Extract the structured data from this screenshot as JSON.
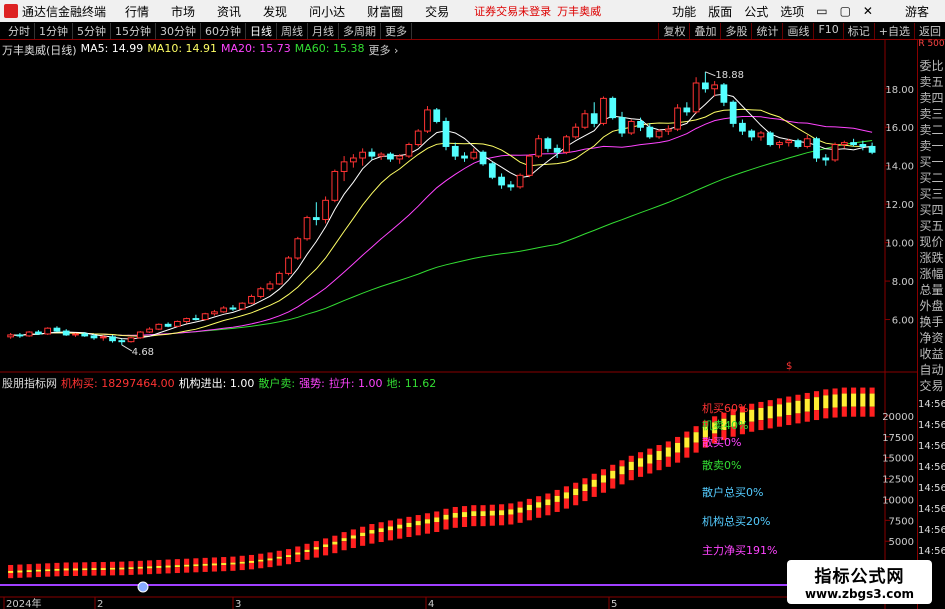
{
  "titlebar": {
    "app_title": "通达信金融终端",
    "menu": [
      "行情",
      "市场",
      "资讯",
      "发现",
      "问小达",
      "财富圈",
      "交易"
    ],
    "warning": "证券交易未登录",
    "stock_name": "万丰奥威",
    "right_items": [
      "功能",
      "版面",
      "公式",
      "选项"
    ],
    "guest": "游客",
    "window_controls": [
      "minimize-icon",
      "restore-icon",
      "close-icon"
    ]
  },
  "toolbar": {
    "periods": [
      "分时",
      "1分钟",
      "5分钟",
      "15分钟",
      "30分钟",
      "60分钟",
      "日线",
      "周线",
      "月线",
      "多周期",
      "更多"
    ],
    "active_period": "日线",
    "tools": [
      "复权",
      "叠加",
      "多股",
      "统计",
      "画线",
      "F10",
      "标记",
      "+自选",
      "返回"
    ]
  },
  "sidebar": {
    "top": "R 500",
    "items": [
      "委比",
      "卖五",
      "卖四",
      "卖三",
      "卖二",
      "卖一",
      "买一",
      "买二",
      "买三",
      "买四",
      "买五",
      "现价",
      "涨跌",
      "涨幅",
      "总量",
      "外盘",
      "换手",
      "净资",
      "收益",
      "自动",
      "交易",
      "14:56",
      "14:56",
      "14:56",
      "14:56",
      "14:56",
      "14:56",
      "14:56",
      "14:56"
    ]
  },
  "main_legend": {
    "name": "万丰奥威(日线)",
    "ma5": "MA5: 14.99",
    "ma10": "MA10: 14.91",
    "ma20": "MA20: 15.73",
    "ma60": "MA60: 15.38",
    "colors": {
      "ma5": "#ffffff",
      "ma10": "#ffff66",
      "ma20": "#ff44ff",
      "ma60": "#33dd33"
    }
  },
  "main_axis": {
    "ticks": [
      "18.00",
      "16.00",
      "14.00",
      "12.00",
      "10.00",
      "8.00",
      "6.00"
    ],
    "high_label": "18.88",
    "low_label": "4.68"
  },
  "ind_legend": {
    "name": "股朋指标网",
    "jgm": "机构买: 18297464.00",
    "jgjc": "机构进出: 1.00",
    "shm": "散户卖:",
    "qs": "强势:",
    "ls": "拉升: 1.00",
    "d": "地: 11.62"
  },
  "ind_axis": {
    "ticks": [
      "20000",
      "17500",
      "15000",
      "12500",
      "10000",
      "7500",
      "5000"
    ]
  },
  "ind_labels": [
    {
      "text": "机买60%",
      "color": "#ff3333"
    },
    {
      "text": "机卖40%",
      "color": "#33dd33"
    },
    {
      "text": "散买0%",
      "color": "#ff44ff"
    },
    {
      "text": "散卖0%",
      "color": "#33dd33"
    },
    {
      "text": "散户总买0%",
      "color": "#55ccff"
    },
    {
      "text": "机构总买20%",
      "color": "#55ccff"
    },
    {
      "text": "主力净买191%",
      "color": "#ff44ff"
    }
  ],
  "time_axis": [
    "2024年",
    "2",
    "3",
    "4",
    "5"
  ],
  "watermark": {
    "line1": "指标公式网",
    "line2": "www.zbgs3.com"
  },
  "chart_data": {
    "type": "candlestick",
    "ylim": [
      4.0,
      19.6
    ],
    "candles": [
      [
        5.1,
        5.3,
        5.0,
        5.2
      ],
      [
        5.2,
        5.3,
        5.05,
        5.15
      ],
      [
        5.15,
        5.4,
        5.1,
        5.35
      ],
      [
        5.35,
        5.45,
        5.2,
        5.25
      ],
      [
        5.25,
        5.6,
        5.2,
        5.55
      ],
      [
        5.55,
        5.65,
        5.35,
        5.4
      ],
      [
        5.4,
        5.5,
        5.15,
        5.2
      ],
      [
        5.2,
        5.3,
        5.1,
        5.25
      ],
      [
        5.25,
        5.35,
        5.1,
        5.15
      ],
      [
        5.15,
        5.25,
        4.95,
        5.05
      ],
      [
        5.05,
        5.2,
        4.9,
        5.1
      ],
      [
        5.1,
        5.2,
        4.8,
        4.9
      ],
      [
        4.9,
        5.0,
        4.68,
        4.85
      ],
      [
        4.85,
        5.1,
        4.8,
        5.05
      ],
      [
        5.05,
        5.4,
        5.0,
        5.35
      ],
      [
        5.35,
        5.6,
        5.3,
        5.5
      ],
      [
        5.5,
        5.8,
        5.45,
        5.75
      ],
      [
        5.75,
        5.85,
        5.6,
        5.65
      ],
      [
        5.65,
        5.95,
        5.6,
        5.9
      ],
      [
        5.9,
        6.1,
        5.8,
        6.05
      ],
      [
        6.05,
        6.25,
        5.95,
        6.0
      ],
      [
        6.0,
        6.35,
        5.95,
        6.3
      ],
      [
        6.3,
        6.5,
        6.2,
        6.4
      ],
      [
        6.4,
        6.7,
        6.35,
        6.6
      ],
      [
        6.6,
        6.75,
        6.45,
        6.55
      ],
      [
        6.55,
        6.9,
        6.5,
        6.85
      ],
      [
        6.85,
        7.3,
        6.8,
        7.2
      ],
      [
        7.2,
        7.7,
        7.1,
        7.6
      ],
      [
        7.6,
        8.0,
        7.5,
        7.85
      ],
      [
        7.85,
        8.5,
        7.8,
        8.4
      ],
      [
        8.4,
        9.3,
        8.3,
        9.2
      ],
      [
        9.2,
        10.3,
        9.1,
        10.2
      ],
      [
        10.2,
        11.4,
        10.1,
        11.3
      ],
      [
        11.3,
        12.1,
        10.9,
        11.2
      ],
      [
        11.2,
        12.4,
        11.0,
        12.2
      ],
      [
        12.2,
        13.8,
        12.1,
        13.7
      ],
      [
        13.7,
        14.5,
        13.2,
        14.2
      ],
      [
        14.2,
        14.6,
        13.9,
        14.4
      ],
      [
        14.4,
        14.9,
        14.0,
        14.7
      ],
      [
        14.7,
        14.9,
        14.3,
        14.5
      ],
      [
        14.5,
        14.7,
        14.3,
        14.6
      ],
      [
        14.6,
        14.7,
        14.2,
        14.35
      ],
      [
        14.35,
        14.6,
        14.1,
        14.5
      ],
      [
        14.5,
        15.2,
        14.4,
        15.1
      ],
      [
        15.1,
        15.9,
        15.0,
        15.8
      ],
      [
        15.8,
        17.1,
        15.7,
        16.9
      ],
      [
        16.9,
        17.0,
        16.2,
        16.3
      ],
      [
        16.3,
        16.5,
        14.8,
        15.0
      ],
      [
        15.0,
        15.2,
        14.3,
        14.5
      ],
      [
        14.5,
        14.7,
        14.2,
        14.4
      ],
      [
        14.4,
        14.9,
        14.3,
        14.7
      ],
      [
        14.7,
        14.8,
        14.0,
        14.1
      ],
      [
        14.1,
        14.2,
        13.3,
        13.4
      ],
      [
        13.4,
        13.6,
        12.8,
        13.0
      ],
      [
        13.0,
        13.2,
        12.7,
        12.9
      ],
      [
        12.9,
        13.6,
        12.8,
        13.5
      ],
      [
        13.5,
        14.6,
        13.4,
        14.5
      ],
      [
        14.5,
        15.6,
        14.4,
        15.4
      ],
      [
        15.4,
        15.5,
        14.7,
        14.9
      ],
      [
        14.9,
        15.1,
        14.4,
        14.7
      ],
      [
        14.7,
        15.6,
        14.6,
        15.5
      ],
      [
        15.5,
        16.2,
        15.4,
        16.0
      ],
      [
        16.0,
        16.9,
        15.9,
        16.7
      ],
      [
        16.7,
        17.3,
        16.0,
        16.2
      ],
      [
        16.2,
        17.6,
        16.1,
        17.5
      ],
      [
        17.5,
        17.6,
        16.4,
        16.5
      ],
      [
        16.5,
        16.8,
        15.5,
        15.7
      ],
      [
        15.7,
        16.4,
        15.6,
        16.3
      ],
      [
        16.3,
        16.5,
        15.8,
        16.0
      ],
      [
        16.0,
        16.2,
        15.4,
        15.5
      ],
      [
        15.5,
        15.9,
        15.4,
        15.8
      ],
      [
        15.8,
        16.1,
        15.6,
        15.9
      ],
      [
        15.9,
        17.2,
        15.8,
        17.0
      ],
      [
        17.0,
        17.3,
        16.6,
        16.8
      ],
      [
        16.8,
        18.6,
        16.7,
        18.3
      ],
      [
        18.3,
        18.88,
        17.8,
        18.0
      ],
      [
        18.0,
        18.4,
        17.6,
        18.2
      ],
      [
        18.2,
        18.3,
        17.1,
        17.3
      ],
      [
        17.3,
        17.4,
        16.0,
        16.2
      ],
      [
        16.2,
        16.4,
        15.6,
        15.8
      ],
      [
        15.8,
        15.9,
        15.3,
        15.5
      ],
      [
        15.5,
        15.8,
        15.3,
        15.7
      ],
      [
        15.7,
        15.8,
        15.0,
        15.1
      ],
      [
        15.1,
        15.3,
        14.9,
        15.2
      ],
      [
        15.2,
        15.4,
        15.0,
        15.3
      ],
      [
        15.3,
        15.4,
        14.9,
        15.0
      ],
      [
        15.0,
        15.6,
        14.9,
        15.4
      ],
      [
        15.4,
        15.5,
        14.2,
        14.4
      ],
      [
        14.4,
        14.6,
        14.0,
        14.3
      ],
      [
        14.3,
        15.2,
        14.2,
        15.1
      ],
      [
        15.1,
        15.3,
        14.9,
        15.2
      ],
      [
        15.2,
        15.4,
        15.0,
        15.1
      ],
      [
        15.1,
        15.3,
        14.8,
        15.0
      ],
      [
        15.0,
        15.2,
        14.6,
        14.7
      ]
    ],
    "indicator": {
      "ylim": [
        0,
        22500
      ],
      "note": "stacked bars: red base with yellow top block",
      "values": [
        1200,
        1250,
        1300,
        1350,
        1400,
        1450,
        1500,
        1500,
        1520,
        1550,
        1550,
        1580,
        1600,
        1650,
        1700,
        1750,
        1800,
        1850,
        1900,
        1950,
        2000,
        2050,
        2100,
        2150,
        2200,
        2300,
        2400,
        2550,
        2700,
        2900,
        3100,
        3400,
        3700,
        4000,
        4300,
        4600,
        5000,
        5300,
        5600,
        5900,
        6100,
        6300,
        6500,
        6700,
        6900,
        7100,
        7300,
        7600,
        7800,
        7900,
        8000,
        8000,
        8050,
        8100,
        8200,
        8400,
        8700,
        9000,
        9300,
        9700,
        10100,
        10500,
        11000,
        11500,
        12000,
        12500,
        13000,
        13500,
        13900,
        14300,
        14700,
        15100,
        15600,
        16200,
        16800,
        17400,
        17900,
        18300,
        18700,
        19000,
        19300,
        19500,
        19700,
        19900,
        20100,
        20300,
        20500,
        20700,
        20900,
        21000,
        21100,
        21100,
        21100,
        21100
      ]
    }
  }
}
